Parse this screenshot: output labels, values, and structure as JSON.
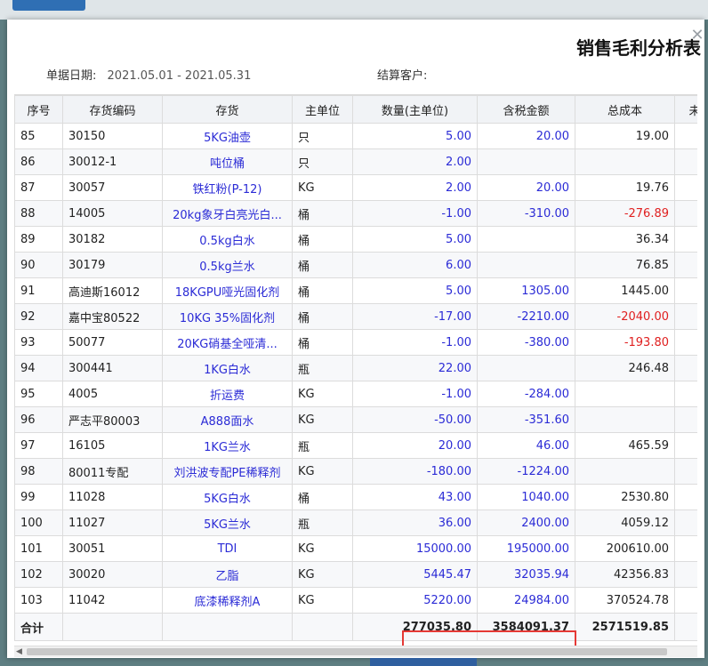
{
  "window": {
    "title": "销售毛利分析表",
    "close_symbol": "✕"
  },
  "meta": {
    "date_label": "单据日期:",
    "date_range": "2021.05.01 - 2021.05.31",
    "customer_label": "结算客户:",
    "customer_value": ""
  },
  "table": {
    "columns": [
      "序号",
      "存货编码",
      "存货",
      "主单位",
      "数量(主单位)",
      "含税金额",
      "总成本",
      "未分"
    ],
    "rows": [
      {
        "no": "85",
        "code": "30150",
        "name": "5KG油壶",
        "unit": "只",
        "qty": "5.00",
        "amount": "20.00",
        "cost": "19.00"
      },
      {
        "no": "86",
        "code": "30012-1",
        "name": "吨位桶",
        "unit": "只",
        "qty": "2.00",
        "amount": "",
        "cost": ""
      },
      {
        "no": "87",
        "code": "30057",
        "name": "铁红粉(P-12)",
        "unit": "KG",
        "qty": "2.00",
        "amount": "20.00",
        "cost": "19.76"
      },
      {
        "no": "88",
        "code": "14005",
        "name": "20kg象牙白亮光白...",
        "unit": "桶",
        "qty": "-1.00",
        "amount": "-310.00",
        "cost": "-276.89"
      },
      {
        "no": "89",
        "code": "30182",
        "name": "0.5kg白水",
        "unit": "桶",
        "qty": "5.00",
        "amount": "",
        "cost": "36.34"
      },
      {
        "no": "90",
        "code": "30179",
        "name": "0.5kg兰水",
        "unit": "桶",
        "qty": "6.00",
        "amount": "",
        "cost": "76.85"
      },
      {
        "no": "91",
        "code": "高迪斯16012",
        "name": "18KGPU哑光固化剂",
        "unit": "桶",
        "qty": "5.00",
        "amount": "1305.00",
        "cost": "1445.00"
      },
      {
        "no": "92",
        "code": "嘉中宝80522",
        "name": "10KG 35%固化剂",
        "unit": "桶",
        "qty": "-17.00",
        "amount": "-2210.00",
        "cost": "-2040.00"
      },
      {
        "no": "93",
        "code": "50077",
        "name": "20KG硝基全哑清...",
        "unit": "桶",
        "qty": "-1.00",
        "amount": "-380.00",
        "cost": "-193.80"
      },
      {
        "no": "94",
        "code": "300441",
        "name": "1KG白水",
        "unit": "瓶",
        "qty": "22.00",
        "amount": "",
        "cost": "246.48"
      },
      {
        "no": "95",
        "code": "4005",
        "name": "折运费",
        "unit": "KG",
        "qty": "-1.00",
        "amount": "-284.00",
        "cost": ""
      },
      {
        "no": "96",
        "code": "严志平80003",
        "name": "A888面水",
        "unit": "KG",
        "qty": "-50.00",
        "amount": "-351.60",
        "cost": ""
      },
      {
        "no": "97",
        "code": "16105",
        "name": "1KG兰水",
        "unit": "瓶",
        "qty": "20.00",
        "amount": "46.00",
        "cost": "465.59"
      },
      {
        "no": "98",
        "code": "80011专配",
        "name": "刘洪波专配PE稀释剂",
        "unit": "KG",
        "qty": "-180.00",
        "amount": "-1224.00",
        "cost": ""
      },
      {
        "no": "99",
        "code": "11028",
        "name": "5KG白水",
        "unit": "桶",
        "qty": "43.00",
        "amount": "1040.00",
        "cost": "2530.80"
      },
      {
        "no": "100",
        "code": "11027",
        "name": "5KG兰水",
        "unit": "瓶",
        "qty": "36.00",
        "amount": "2400.00",
        "cost": "4059.12"
      },
      {
        "no": "101",
        "code": "30051",
        "name": "TDI",
        "unit": "KG",
        "qty": "15000.00",
        "amount": "195000.00",
        "cost": "200610.00"
      },
      {
        "no": "102",
        "code": "30020",
        "name": "乙脂",
        "unit": "KG",
        "qty": "5445.47",
        "amount": "32035.94",
        "cost": "42356.83"
      },
      {
        "no": "103",
        "code": "11042",
        "name": "底漆稀释剂A",
        "unit": "KG",
        "qty": "5220.00",
        "amount": "24984.00",
        "cost": "370524.78"
      }
    ],
    "footer": {
      "label": "合计",
      "qty_total": "277035.80",
      "amount_total": "3584091.37",
      "cost_total": "2571519.85"
    }
  },
  "colors": {
    "link_blue": "#2b2bd6",
    "negative_red": "#e02020",
    "highlight_border": "#e53935"
  }
}
